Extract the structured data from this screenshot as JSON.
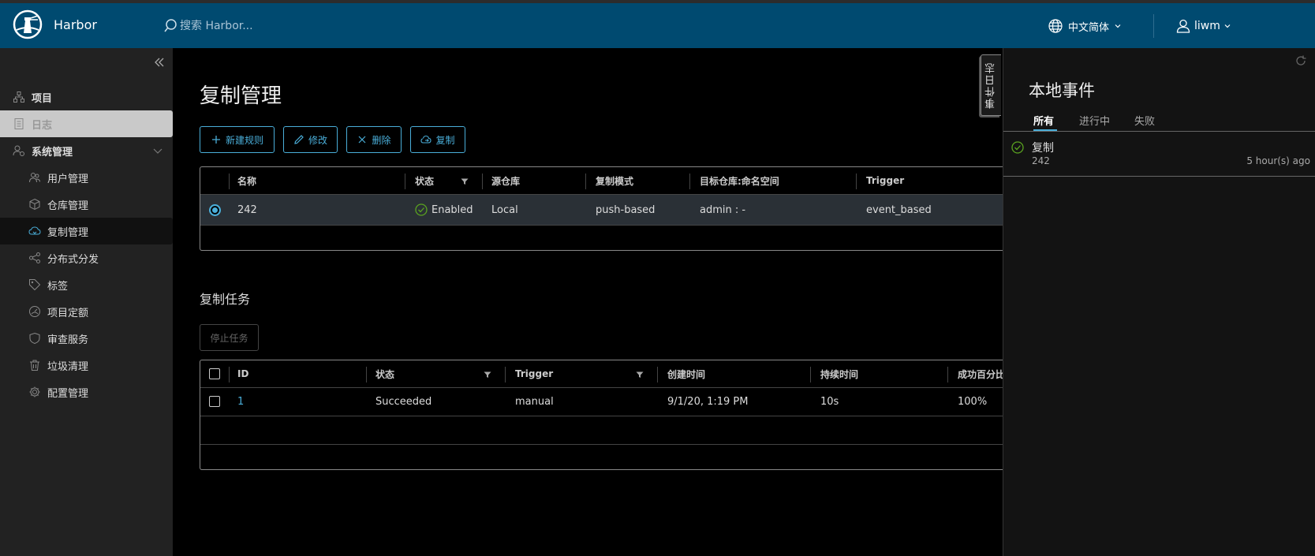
{
  "header": {
    "brand": "Harbor",
    "search_placeholder": "搜索 Harbor...",
    "language": "中文简体",
    "user": "liwm"
  },
  "sidebar": {
    "items": [
      {
        "label": "项目",
        "icon": "projects-icon",
        "level": "top"
      },
      {
        "label": "日志",
        "icon": "logs-icon",
        "level": "top"
      },
      {
        "label": "系统管理",
        "icon": "admin-icon",
        "level": "top"
      },
      {
        "label": "用户管理",
        "icon": "users-icon",
        "level": "sub"
      },
      {
        "label": "仓库管理",
        "icon": "registry-icon",
        "level": "sub"
      },
      {
        "label": "复制管理",
        "icon": "replication-icon",
        "level": "sub"
      },
      {
        "label": "分布式分发",
        "icon": "distribution-icon",
        "level": "sub"
      },
      {
        "label": "标签",
        "icon": "tag-icon",
        "level": "sub"
      },
      {
        "label": "项目定额",
        "icon": "quota-icon",
        "level": "sub"
      },
      {
        "label": "审查服务",
        "icon": "shield-icon",
        "level": "sub"
      },
      {
        "label": "垃圾清理",
        "icon": "trash-icon",
        "level": "sub"
      },
      {
        "label": "配置管理",
        "icon": "gear-icon",
        "level": "sub"
      }
    ]
  },
  "main": {
    "title": "复制管理",
    "toolbar": {
      "new_rule": "新建规则",
      "edit": "修改",
      "delete": "删除",
      "replicate": "复制"
    },
    "rules_table": {
      "columns": [
        "名称",
        "状态",
        "源仓库",
        "复制模式",
        "目标仓库:命名空间",
        "Trigger"
      ],
      "rows": [
        {
          "name": "242",
          "status": "Enabled",
          "source": "Local",
          "mode": "push-based",
          "target": "admin : -",
          "trigger": "event_based"
        }
      ]
    },
    "tasks_title": "复制任务",
    "stop_button": "停止任务",
    "tasks_table": {
      "columns": [
        "ID",
        "状态",
        "Trigger",
        "创建时间",
        "持续时间",
        "成功百分比"
      ],
      "rows": [
        {
          "id": "1",
          "status": "Succeeded",
          "trigger": "manual",
          "created": "9/1/20, 1:19 PM",
          "duration": "10s",
          "success_rate": "100%"
        }
      ]
    }
  },
  "events_tab": "事件日志",
  "panel": {
    "title": "本地事件",
    "tabs": [
      "所有",
      "进行中",
      "失败"
    ],
    "events": [
      {
        "name": "复制",
        "sub": "242",
        "time": "5 hour(s) ago"
      }
    ]
  },
  "colors": {
    "header": "#004a70",
    "accent": "#4aaed9",
    "success": "#5aa220"
  }
}
